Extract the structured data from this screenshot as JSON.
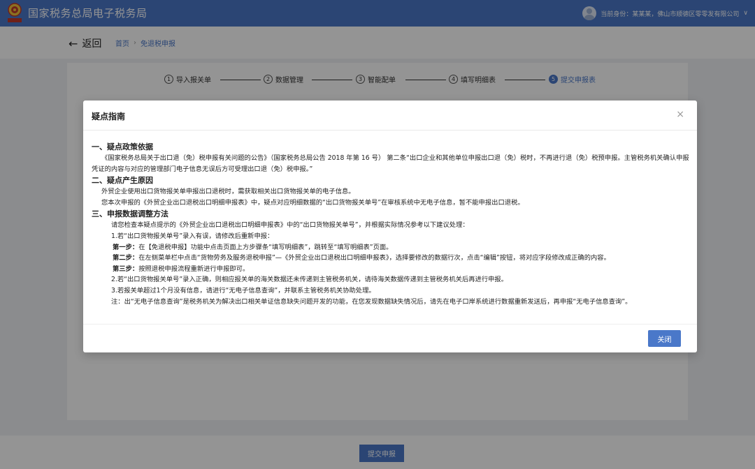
{
  "header": {
    "site_title": "国家税务总局电子税务局",
    "user_label": "当前身份：某某某，佛山市顺德区零零发有限公司",
    "chevron": "∨"
  },
  "nav": {
    "back_label": "返回",
    "back_arrow": "←",
    "breadcrumb": [
      "首页",
      "免退税申报"
    ],
    "breadcrumb_sep": "›"
  },
  "steps": [
    {
      "num": "1",
      "label": "导入报关单",
      "active": false
    },
    {
      "num": "2",
      "label": "数据管理",
      "active": false
    },
    {
      "num": "3",
      "label": "智能配单",
      "active": false
    },
    {
      "num": "4",
      "label": "填写明细表",
      "active": false
    },
    {
      "num": "5",
      "label": "提交申报表",
      "active": true
    }
  ],
  "footer": {
    "submit_label": "提交申报"
  },
  "modal": {
    "title": "疑点指南",
    "close_icon": "×",
    "close_label": "关闭",
    "sections": [
      {
        "heading": "一、疑点政策依据",
        "lines": [
          "《国家税务总局关于出口退（免）税申报有关问题的公告》（国家税务总局公告 2018 年第 16 号） 第二条“出口企业和其他单位申报出口退（免）税时，不再进行退（免）税预申报。主管税务机关确认申报凭证的内容与对应的管理部门电子信息无误后方可受理出口退（免）税申报。”"
        ]
      },
      {
        "heading": "二、疑点产生原因",
        "lines": [
          "外贸企业使用出口货物报关单申报出口退税时，需获取相关出口货物报关单的电子信息。",
          "您本次申报的《外贸企业出口退税出口明细申报表》中，疑点对应明细数据的“出口货物报关单号”在审核系统中无电子信息，暂不能申报出口退税。"
        ]
      },
      {
        "heading": "三、申报数据调整方法",
        "intro": "请您检查本疑点提示的《外贸企业出口退税出口明细申报表》中的“出口货物报关单号”，并根据实际情况参考以下建议处理：",
        "item1": "1.若“出口货物报关单号”录入有误，请修改后重新申报：",
        "step1_label": "第一步：",
        "step1_text": "在【免退税申报】功能中点击页面上方步骤条“填写明细表”，跳转至“填写明细表”页面。",
        "step2_label": "第二步：",
        "step2_text": "在左侧菜单栏中点击“货物劳务及服务退税申报”—《外贸企业出口退税出口明细申报表》，选择要修改的数据行次，点击“编辑”按钮，将对应字段修改成正确的内容。",
        "step3_label": "第三步：",
        "step3_text": "按照退税申报流程重新进行申报即可。",
        "item2": "2.若“出口货物报关单号”录入正确，则相应报关单的海关数据还未传递到主管税务机关，请待海关数据传递到主管税务机关后再进行申报。",
        "item3": "3.若报关单超过1个月没有信息，请进行“无电子信息查询”，并联系主管税务机关协助处理。",
        "note": "注：出“无电子信息查询”是税务机关为解决出口相关单证信息缺失问题开发的功能，在您发现数据缺失情况后，请先在电子口岸系统进行数据重新发送后，再申报“无电子信息查询”。"
      }
    ]
  },
  "colors": {
    "brand": "#4a78c9",
    "overlay": "rgba(0,0,0,0.42)"
  },
  "icons": {
    "emblem": "tax-emblem-icon",
    "avatar": "user-avatar-icon",
    "back": "arrow-left-icon",
    "close": "close-icon"
  }
}
